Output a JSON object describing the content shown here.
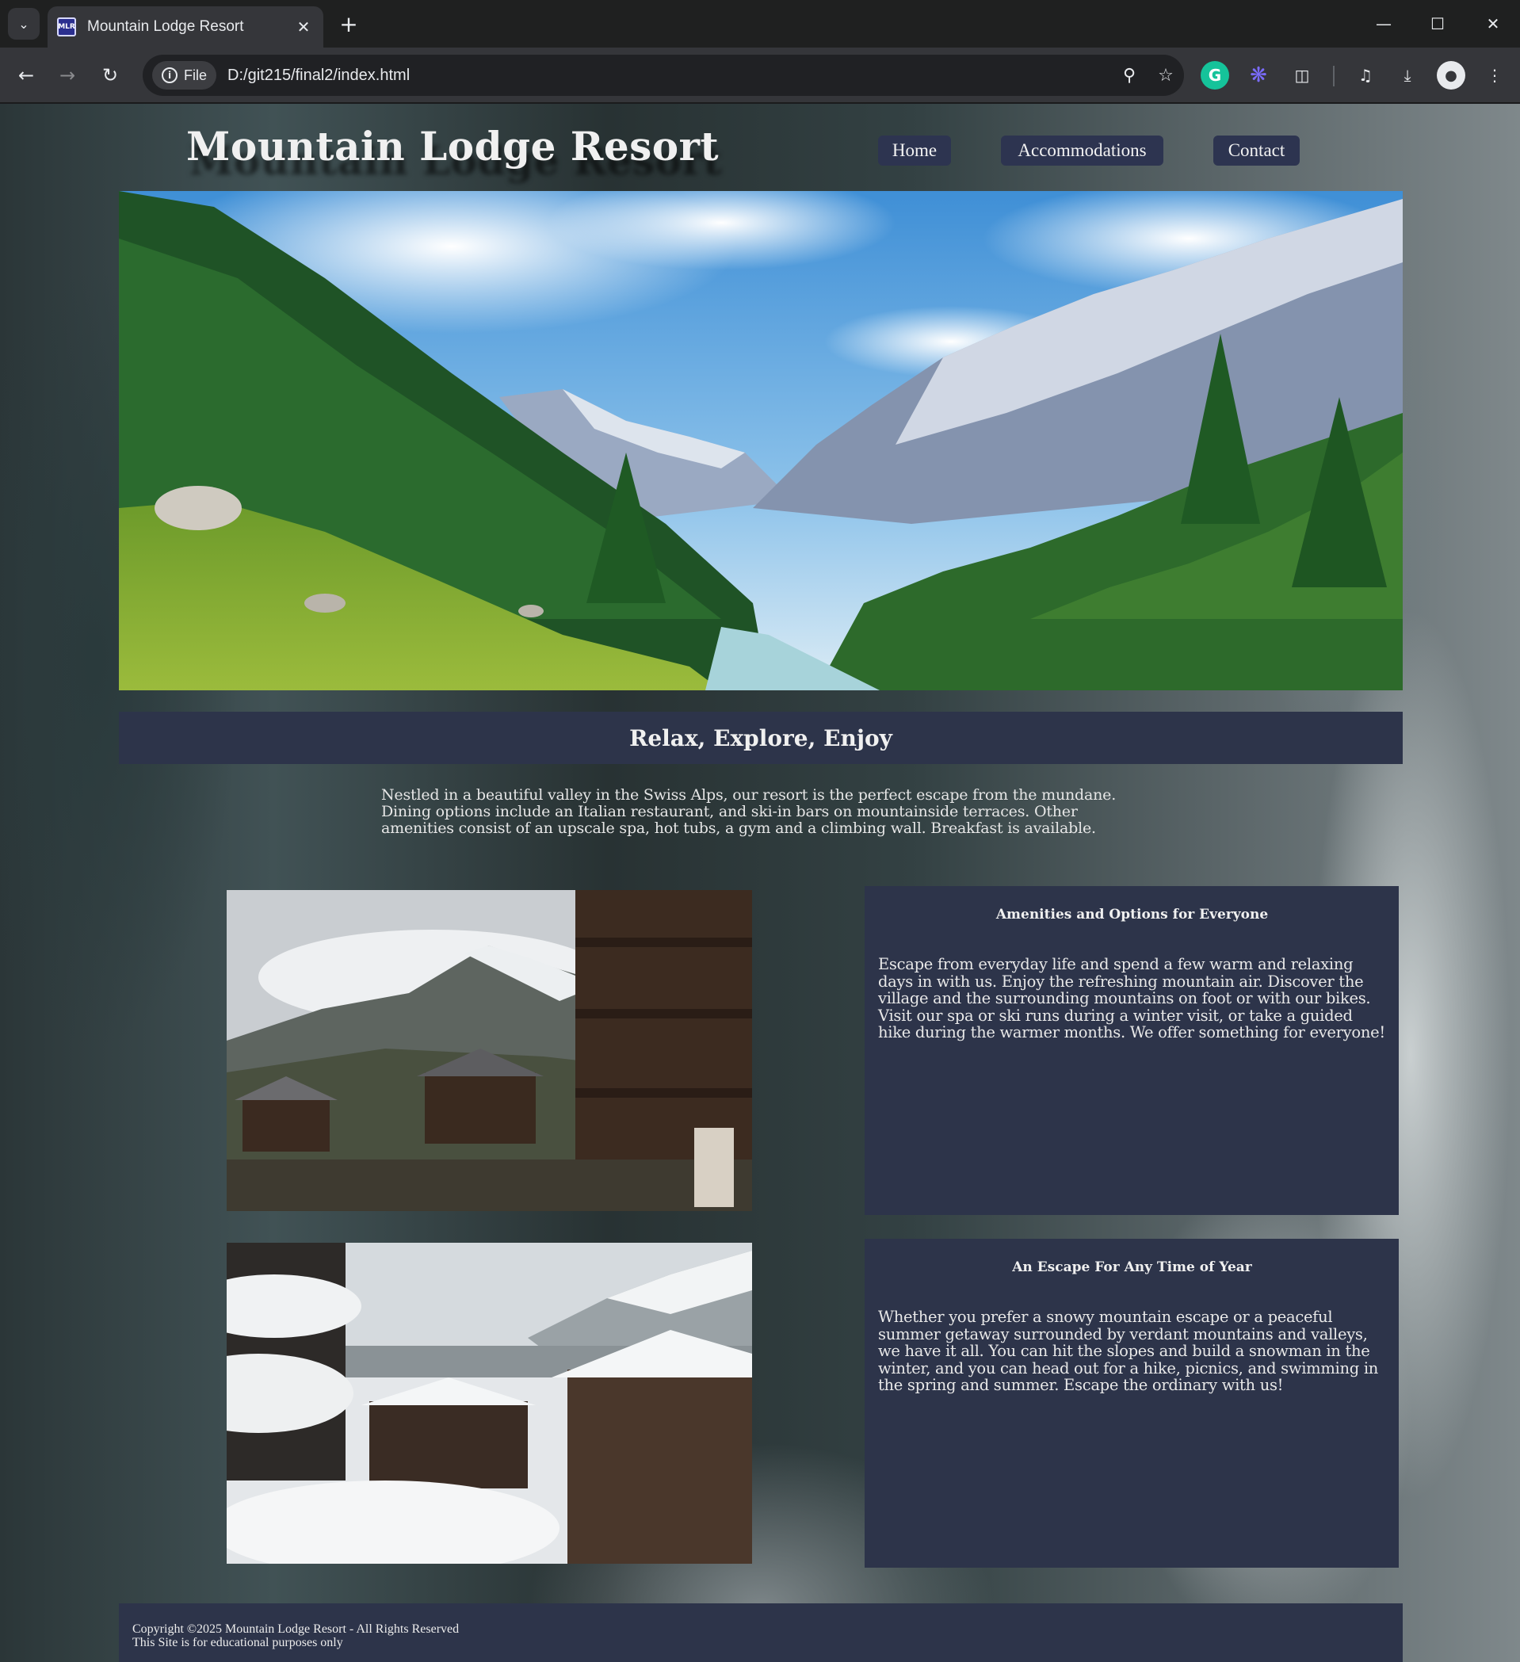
{
  "browser": {
    "tab_title": "Mountain Lodge Resort",
    "favicon_text": "MLR",
    "site_chip": "File",
    "url": "D:/git215/final2/index.html",
    "icons": {
      "tab_search": "chevron-down-icon",
      "tab_close": "close-icon",
      "new_tab": "plus-icon",
      "minimize": "minimize-icon",
      "maximize": "maximize-icon",
      "close": "close-icon",
      "back": "back-arrow-icon",
      "forward": "forward-arrow-icon",
      "reload": "reload-icon",
      "zoom": "zoom-icon",
      "bookmark": "star-icon",
      "grammarly": "grammarly-icon",
      "extension_purple": "sparkle-icon",
      "extensions": "puzzle-icon",
      "media": "media-controls-icon",
      "downloads": "download-icon",
      "profile": "profile-avatar",
      "menu": "kebab-menu-icon"
    }
  },
  "site": {
    "title": "Mountain Lodge Resort",
    "nav": [
      "Home",
      "Accommodations",
      "Contact"
    ],
    "tagline": "Relax, Explore, Enjoy",
    "intro": "Nestled in a beautiful valley in the Swiss Alps, our resort is the perfect escape from the mundane. Dining options include an Italian restaurant, and ski-in bars on mountainside terraces. Other amenities consist of an upscale spa, hot tubs, a gym and a climbing wall. Breakfast is available.",
    "cards": [
      {
        "title": "Amenities and Options for Everyone",
        "text": "Escape from everyday life and spend a few warm and relaxing days in with us. Enjoy the refreshing mountain air. Discover the village and the surrounding mountains on foot or with our bikes. Visit our spa or ski runs during a winter visit, or take a guided hike during the warmer months. We offer something for everyone!"
      },
      {
        "title": "An Escape For Any Time of Year",
        "text": "Whether you prefer a snowy mountain escape or a peaceful summer getaway surrounded by verdant mountains and valleys, we have it all. You can hit the slopes and build a snowman in the winter, and you can head out for a hike, picnics, and swimming in the spring and summer. Escape the ordinary with us!"
      }
    ],
    "footer": {
      "copyright": "Copyright ©2025 Mountain Lodge Resort - All Rights Reserved",
      "note": "This Site is for educational purposes only"
    },
    "colors": {
      "panel": "#2d344a",
      "text": "#f0f0f0"
    }
  }
}
